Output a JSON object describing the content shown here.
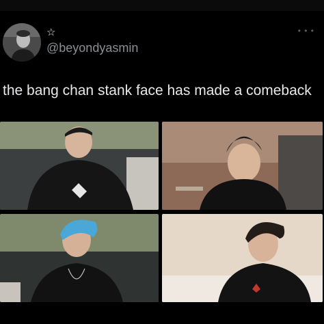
{
  "tweet": {
    "display_name": "☆",
    "handle": "@beyondyasmin",
    "more_icon": "more-dots-icon",
    "text": "the bang chan stank face has made a comeback"
  },
  "media": {
    "layout": "2x2-grid",
    "tiles": [
      {
        "position": "top-left",
        "scene": "person in black hoodie on grey sofa"
      },
      {
        "position": "top-right",
        "scene": "person in black tank top near lamp"
      },
      {
        "position": "bottom-left",
        "scene": "person with blue hair in black shirt"
      },
      {
        "position": "bottom-right",
        "scene": "person in black tank top, bright room"
      }
    ]
  },
  "colors": {
    "background": "#000000",
    "text_primary": "#e7e9ea",
    "text_secondary": "#8b8f93"
  }
}
